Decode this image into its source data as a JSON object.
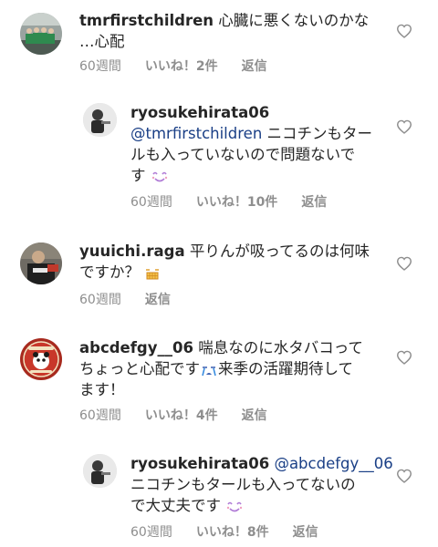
{
  "comments": [
    {
      "username": "tmrfirstchildren",
      "text": "心臓に悪くないのかな…心配",
      "line1": "心臓に悪くないのかな",
      "line2": "…心配",
      "time": "60週間",
      "likes": "いいね！2件",
      "reply": "返信"
    },
    {
      "username": "ryosukehirata06",
      "mention": "@tmrfirstchildren",
      "text": "ニコチンもタールも入っていないので問題ないです",
      "line1": "ニコチンもター",
      "line2": "ルも入っていないので問題ないで",
      "line3": "す",
      "emoji": "smiling-face-icon",
      "time": "60週間",
      "likes": "いいね！10件",
      "reply": "返信"
    },
    {
      "username": "yuuichi.raga",
      "text": "平りんが吸ってるのは何味ですか？",
      "line1": "平りんが吸ってるのは何味",
      "line2": "ですか？",
      "emoji": "grinning-face-icon",
      "time": "60週間",
      "reply": "返信"
    },
    {
      "username": "abcdefgy__06",
      "text": "喘息なのに水タバコってちょっと心配です来季の活躍期待してます！",
      "line1": "喘息なのに水タバコって",
      "line2a": "ちょっと心配です",
      "line2b": "来季の活躍期待して",
      "line3": "ます！",
      "emoji": "loudly-crying-face-icon",
      "time": "60週間",
      "likes": "いいね！4件",
      "reply": "返信"
    },
    {
      "username": "ryosukehirata06",
      "mention": "@abcdefgy__06",
      "text": "ニコチンもタールも入ってないので大丈夫です",
      "line1": "ニコチンもタールも入ってないの",
      "line2": "で大丈夫です",
      "emoji": "smiling-face-icon",
      "time": "60週間",
      "likes": "いいね！8件",
      "reply": "返信"
    }
  ],
  "colors": {
    "text": "#262626",
    "meta": "#8e8e8e",
    "mention": "#1a3f86",
    "heart": "#8e8e8e"
  }
}
